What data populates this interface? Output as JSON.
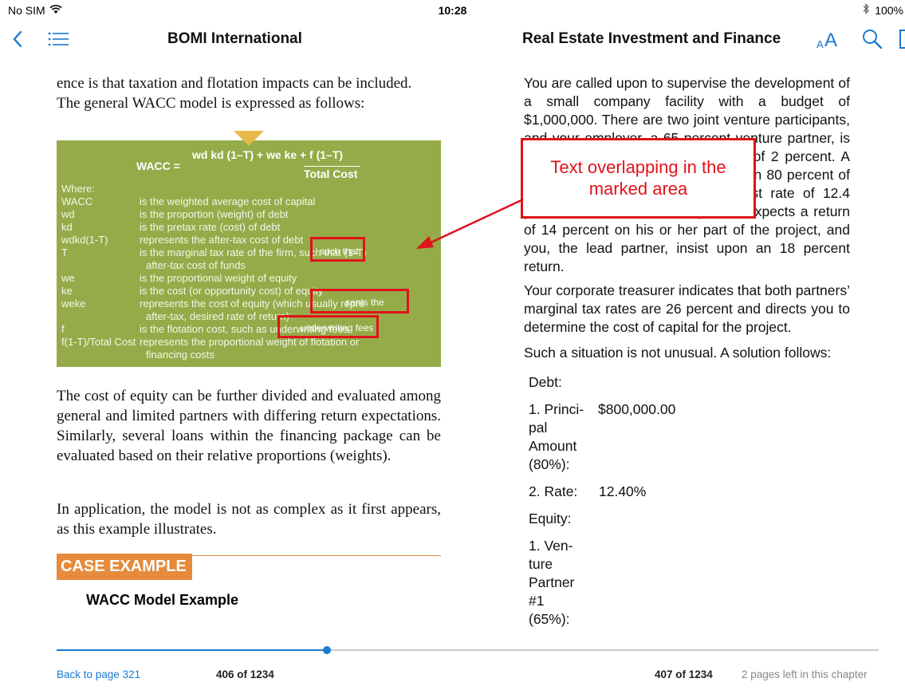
{
  "status_bar": {
    "carrier": "No SIM",
    "time": "10:28",
    "battery": "100%"
  },
  "nav": {
    "left_title": "BOMI International",
    "right_title": "Real Estate Investment and Finance",
    "icons": [
      "back-chevron-icon",
      "table-of-contents-icon",
      "font-size-icon",
      "search-icon",
      "bookmark-icon"
    ],
    "accent_color": "#1a7ad4"
  },
  "left_page": {
    "paragraph_top_lines": [
      "ence is that taxation and flotation impacts can be included.",
      "The general WACC model is expressed as follows:"
    ],
    "formula": {
      "lhs": "WACC =",
      "numerator": "wd kd (1–T) + we ke +  f (1–T)",
      "denominator": "Total Cost"
    },
    "definitions": [
      {
        "symbol": "Where:",
        "description": ""
      },
      {
        "symbol": "WACC",
        "description": "is the weighted average cost of capital"
      },
      {
        "symbol": "wd",
        "description": "is the proportion (weight) of debt"
      },
      {
        "symbol": "kd",
        "description": "is the pretax rate (cost) of debt"
      },
      {
        "symbol": "wdkd(1-T)",
        "description": "represents the after-tax cost of debt"
      },
      {
        "symbol": "T",
        "description": "is the marginal tax rate of the firm, such that (1-T)"
      },
      {
        "symbol": "",
        "description": "after-tax cost of funds"
      },
      {
        "symbol": "we",
        "description": "is the proportional weight of equity"
      },
      {
        "symbol": "ke",
        "description": "is the cost (or opportunity cost) of equity"
      },
      {
        "symbol": "weke",
        "description": "represents the cost of equity (which usually repre"
      },
      {
        "symbol": "",
        "description": "after-tax, desired rate of return)"
      },
      {
        "symbol": "f",
        "description": "is the flotation cost, such as underwriting fees"
      },
      {
        "symbol": "f(1-T)/Total Cost",
        "description": "represents the proportional weight of flotation or"
      },
      {
        "symbol": "",
        "description": "financing costs"
      }
    ],
    "overlaps": [
      "such that",
      "sents the",
      "underwriting fees"
    ],
    "paragraph_mid1": "The cost of equity can be further divided and evaluated among general and limited partners with differing return expectations. Similarly, several loans within the financing package can be evaluated based on their relative proportions (weights).",
    "paragraph_mid2": "In application, the model is not as complex as it first appears, as this example illustrates.",
    "case_badge": "CASE EXAMPLE",
    "case_title": "WACC Model Example"
  },
  "right_page": {
    "paragraph_1": "You are called upon to supervise the development of a small company facility with a budget of $1,000,000. There are two joint venture participants, and your employer, a 65 percent venture partner, is responsible for an underwriting fee of 2 percent. A lender has been found which will loan 80 percent of the budgeted amount at an interest rate of 12.4 percent. The other venture partner expects a return of 14 percent on his or her part of the project, and you, the lead partner, insist upon an 18 percent return.",
    "paragraph_2": "Your corporate treasurer indicates that both partners’ marginal tax rates are 26 percent and directs you to determine the cost of capital for the project.",
    "paragraph_3": "Such a situation is not unusual. A solution follows:",
    "debt_label": "Debt:",
    "principal_label": [
      "1. Princi-",
      "pal",
      "Amount",
      "(80%):"
    ],
    "principal_value": "$800,000.00",
    "rate_label": "2. Rate:",
    "rate_value": "12.40%",
    "equity_label": "Equity:",
    "venture_label": [
      "1. Ven-",
      "ture",
      "Partner",
      "#1",
      "(65%):"
    ]
  },
  "annotation": {
    "text": "Text overlapping in the marked area",
    "color": "#e0121a"
  },
  "footer": {
    "back_link": "Back to page 321",
    "left_page_number": "406 of 1234",
    "right_page_number": "407 of 1234",
    "chapter_remaining": "2 pages left in this chapter",
    "progress_fraction": 0.329
  }
}
